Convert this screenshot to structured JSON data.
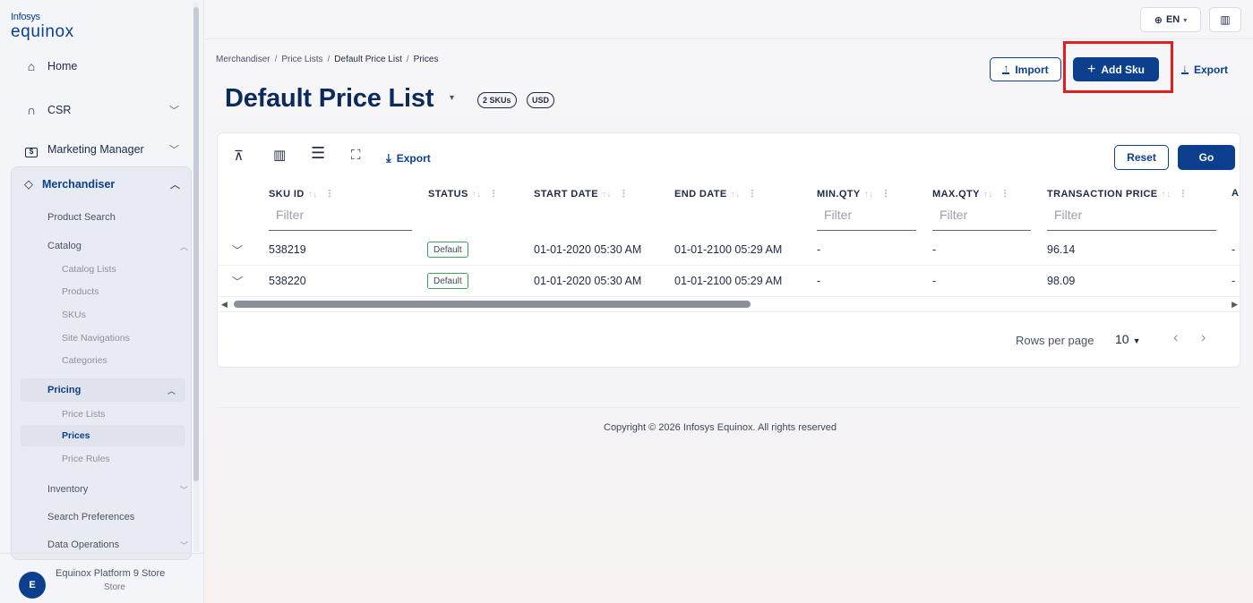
{
  "brand": {
    "line1": "Infosys",
    "line2": "equinox"
  },
  "nav": {
    "home": "Home",
    "csr": "CSR",
    "marketing": "Marketing Manager",
    "merchandiser": "Merchandiser",
    "merch_items": {
      "product_search": "Product Search",
      "catalog": "Catalog",
      "catalog_lists": "Catalog Lists",
      "products": "Products",
      "skus": "SKUs",
      "site_navigations": "Site Navigations",
      "categories": "Categories",
      "pricing": "Pricing",
      "price_lists": "Price Lists",
      "prices": "Prices",
      "price_rules": "Price Rules",
      "inventory": "Inventory",
      "search_preferences": "Search Preferences",
      "data_operations": "Data Operations"
    }
  },
  "store": {
    "avatar": "E",
    "name": "Equinox Platform 9 Store",
    "type": "Store"
  },
  "topbar": {
    "language": "EN"
  },
  "breadcrumb": [
    "Merchandiser",
    "Price Lists",
    "Default Price List",
    "Prices"
  ],
  "page": {
    "title": "Default Price List",
    "sku_count": "2 SKUs",
    "currency": "USD"
  },
  "actions": {
    "import": "Import",
    "add_sku": "Add Sku",
    "export": "Export"
  },
  "toolbar": {
    "export": "Export",
    "reset": "Reset",
    "go": "Go"
  },
  "table": {
    "columns": [
      "SKU ID",
      "STATUS",
      "START DATE",
      "END DATE",
      "MIN.QTY",
      "MAX.QTY",
      "TRANSACTION PRICE",
      "A"
    ],
    "filter_placeholder": "Filter",
    "rows": [
      {
        "sku_id": "538219",
        "status": "Default",
        "start_date": "01-01-2020 05:30 AM",
        "end_date": "01-01-2100 05:29 AM",
        "min_qty": "-",
        "max_qty": "-",
        "price": "96.14",
        "extra": "-"
      },
      {
        "sku_id": "538220",
        "status": "Default",
        "start_date": "01-01-2020 05:30 AM",
        "end_date": "01-01-2100 05:29 AM",
        "min_qty": "-",
        "max_qty": "-",
        "price": "98.09",
        "extra": "-"
      }
    ]
  },
  "pagination": {
    "label": "Rows per page",
    "value": "10"
  },
  "footer": {
    "copyright": "Copyright © 2026 Infosys Equinox. All rights reserved"
  },
  "colors": {
    "brand": "#0c3f8d",
    "highlight": "#e0201e",
    "status_border": "#3aa35a"
  }
}
